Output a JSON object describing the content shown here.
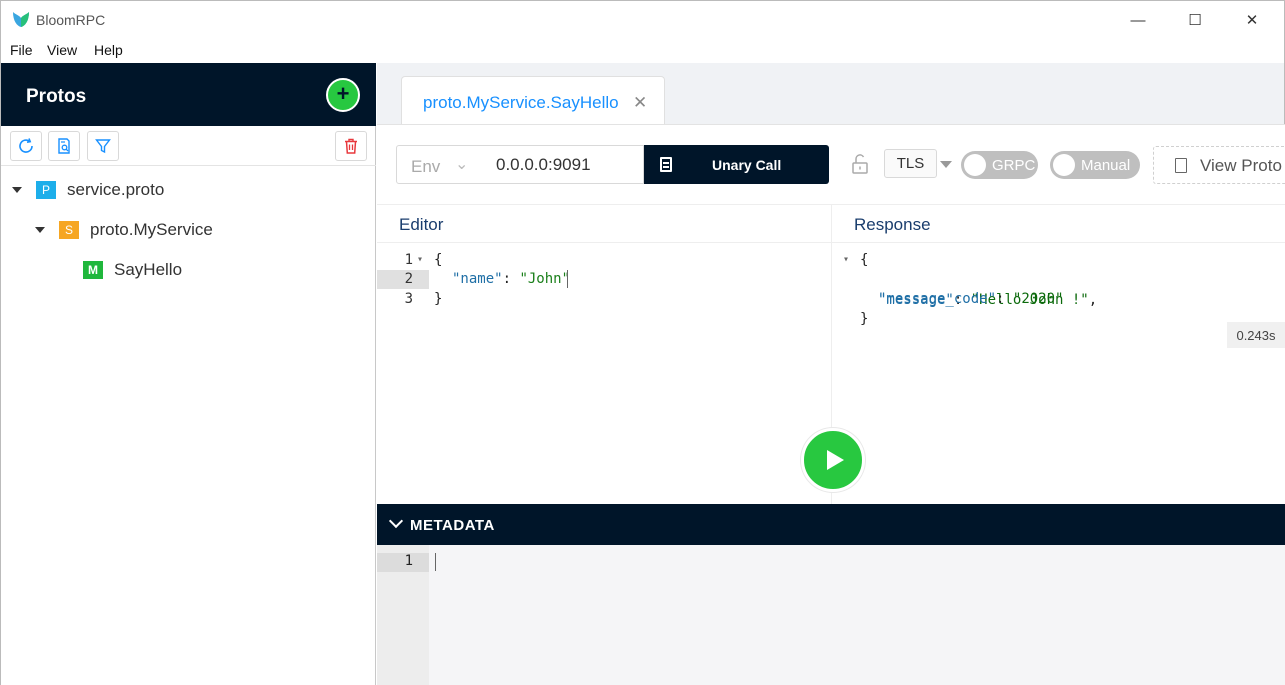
{
  "window": {
    "title": "BloomRPC",
    "minimize": "—",
    "maximize": "☐",
    "close": "✕"
  },
  "menu": [
    "File",
    "View",
    "Help"
  ],
  "sidebar": {
    "title": "Protos",
    "add_icon": "+",
    "tree": [
      {
        "badge": "P",
        "label": "service.proto"
      },
      {
        "badge": "S",
        "label": "proto.MyService"
      },
      {
        "badge": "M",
        "label": "SayHello"
      }
    ]
  },
  "tab": {
    "label": "proto.MyService.SayHello",
    "close": "✕"
  },
  "request": {
    "env_placeholder": "Env",
    "env_chevron": "⌄",
    "address": "0.0.0.0:9091",
    "call_type": "Unary Call",
    "tls": "TLS",
    "grpc_label": "GRPC",
    "manual_label": "Manual",
    "view_proto": "View Proto"
  },
  "editor": {
    "title": "Editor",
    "lines": [
      "1",
      "2",
      "3"
    ],
    "open": "{",
    "key": "\"name\"",
    "colon": ":",
    "value": "\"John\"",
    "close": "}"
  },
  "response": {
    "title": "Response",
    "time": "0.243s",
    "open": "{",
    "k1": "\"message\"",
    "v1": "\"Hello John !\"",
    "comma": ",",
    "k2": "\"message_code\"",
    "v2": "\"2020\"",
    "colon": ":",
    "close": "}"
  },
  "metadata": {
    "title": "METADATA",
    "line": "1"
  }
}
